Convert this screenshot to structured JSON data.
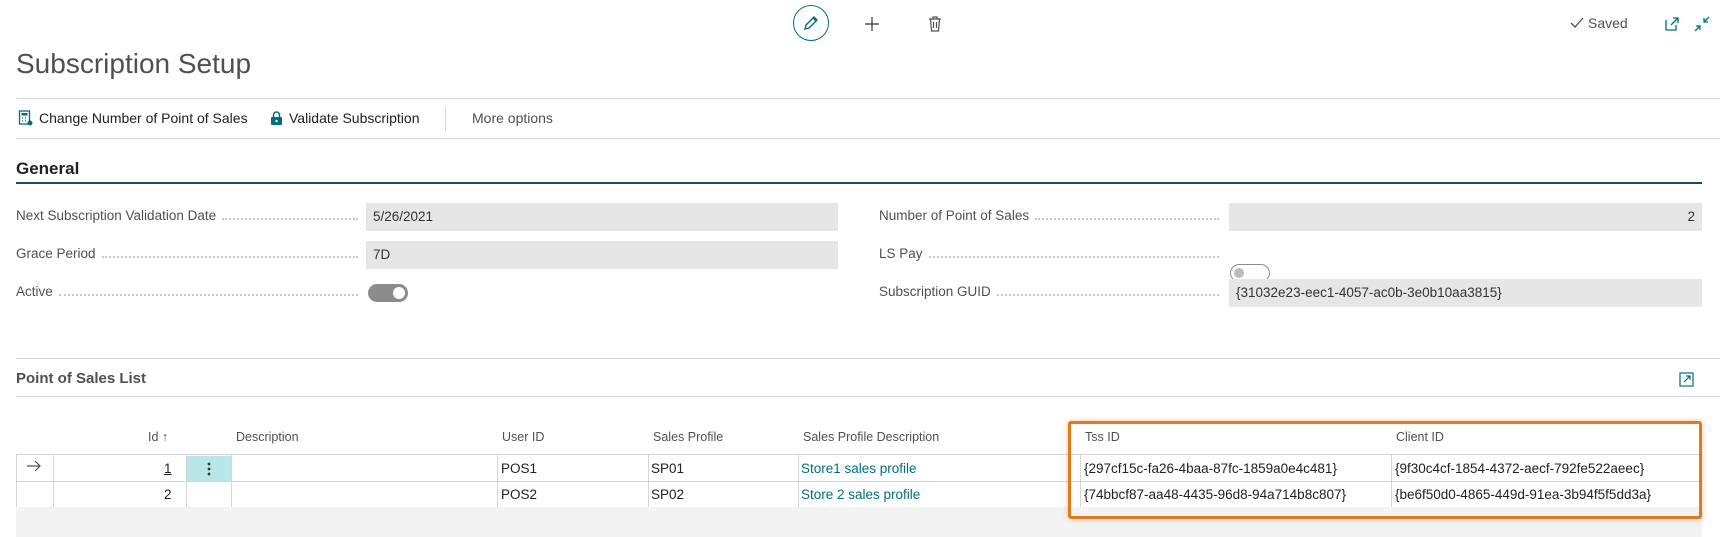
{
  "header": {
    "title": "Subscription Setup",
    "status": "Saved",
    "edit_icon": "pencil-icon",
    "new_icon": "plus-icon",
    "delete_icon": "trash-icon",
    "open_new_window_icon": "open-in-new-icon",
    "collapse_icon": "collapse-icon"
  },
  "actions": {
    "change_number": "Change Number of Point of Sales",
    "validate": "Validate Subscription",
    "more": "More options"
  },
  "general": {
    "title": "General",
    "fields_left": [
      {
        "label": "Next Subscription Validation Date",
        "value": "5/26/2021"
      },
      {
        "label": "Grace Period",
        "value": "7D"
      },
      {
        "label": "Active",
        "toggle": true
      }
    ],
    "fields_right": [
      {
        "label": "Number of Point of Sales",
        "value": "2"
      },
      {
        "label": "LS Pay",
        "toggle": false
      },
      {
        "label": "Subscription GUID",
        "value": "{31032e23-eec1-4057-ac0b-3e0b10aa3815}"
      }
    ]
  },
  "pos_list": {
    "title": "Point of Sales List",
    "columns": {
      "id": "Id",
      "sort_indicator": "↑",
      "description": "Description",
      "user_id": "User ID",
      "sales_profile": "Sales Profile",
      "sales_profile_description": "Sales Profile Description",
      "tss_id": "Tss ID",
      "client_id": "Client ID"
    },
    "rows": [
      {
        "id": "1",
        "description": "",
        "user_id": "POS1",
        "sales_profile": "SP01",
        "sales_profile_description": "Store1 sales profile",
        "tss_id": "{297cf15c-fa26-4baa-87fc-1859a0e4c481}",
        "client_id": "{9f30c4cf-1854-4372-aecf-792fe522aeec}"
      },
      {
        "id": "2",
        "description": "",
        "user_id": "POS2",
        "sales_profile": "SP02",
        "sales_profile_description": "Store 2 sales profile",
        "tss_id": "{74bbcf87-aa48-4435-96d8-94a714b8c807}",
        "client_id": "{be6f50d0-4865-449d-91ea-3b94f5f5dd3a}"
      }
    ]
  },
  "colors": {
    "accent": "#00707b",
    "highlight": "#e07a1e"
  }
}
